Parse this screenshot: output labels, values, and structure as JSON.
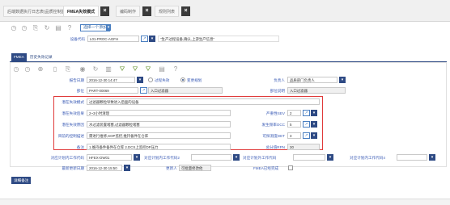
{
  "tabs": [
    {
      "label": "后端数据执行日志表(品质控制监控)",
      "active": false
    },
    {
      "label": "FMEA失效模式",
      "active": true
    },
    {
      "label": "编码制作",
      "active": false
    },
    {
      "label": "规则列表",
      "active": false
    }
  ],
  "toolbar": {
    "select_btn": "选择一个添加"
  },
  "equipment": {
    "label": "设备代码",
    "value": "L01-PROC-AGFH",
    "desc": "\"生产过程设备,确认,上游生产信息\""
  },
  "section": {
    "active_tab": "FMEA",
    "tab2": "历史失效记录"
  },
  "form": {
    "report_date": {
      "label": "报告日期",
      "value": "2016-12-30 14:47"
    },
    "radio1": {
      "label": "过程失效"
    },
    "radio2": {
      "label": "变更规划"
    },
    "owner": {
      "label": "负责人",
      "value": "品质部门负责人"
    },
    "part": {
      "label": "部位",
      "value": "PART-00069"
    },
    "part_desc": {
      "value": "入口过滤器"
    },
    "part_desc_label": {
      "label": "部位说明"
    },
    "part_desc_value": {
      "value": "入口过滤器"
    },
    "failure_mode": {
      "label": "潜在失效模式",
      "value": "过滤器颗粒导致进入后面的设备"
    },
    "failure_effect": {
      "label": "潜在失效后果",
      "value": "2~3小时清理"
    },
    "failure_cause": {
      "label": "潜在失效原因",
      "value": "水过滤装置堵塞,过滤器颗粒堵塞"
    },
    "control": {
      "label": "目前的控制描述",
      "value": "需进行维修,SOP监控,维持备件在仓库"
    },
    "remark": {
      "label": "备注",
      "value": "1.维持备件备件在仓库 2.DCS上监控DP压力"
    },
    "sev": {
      "label": "严重性SEV",
      "value": "2"
    },
    "occ": {
      "label": "发生频率OCC",
      "value": "5"
    },
    "det": {
      "label": "可探测度DET",
      "value": "3"
    },
    "rpn": {
      "label": "总分值RPN",
      "value": "30"
    },
    "wo1": {
      "label": "对应计划内工作代码",
      "value": "HFEX-DW01"
    },
    "wo2": {
      "label": "对应计划内工作代码2",
      "value": ""
    },
    "wo3": {
      "label": "对应计划外工作代码",
      "value": ""
    },
    "wo4": {
      "label": "对应计划内工作代码4",
      "value": ""
    },
    "update_date": {
      "label": "最新更新日期",
      "value": "2016-12-30 15:50"
    },
    "updater": {
      "label": "更新人",
      "value": "可批量修改他"
    },
    "fmea_done": {
      "label": "FMEA已经完成"
    }
  },
  "bottom": {
    "button": "详细备注"
  }
}
